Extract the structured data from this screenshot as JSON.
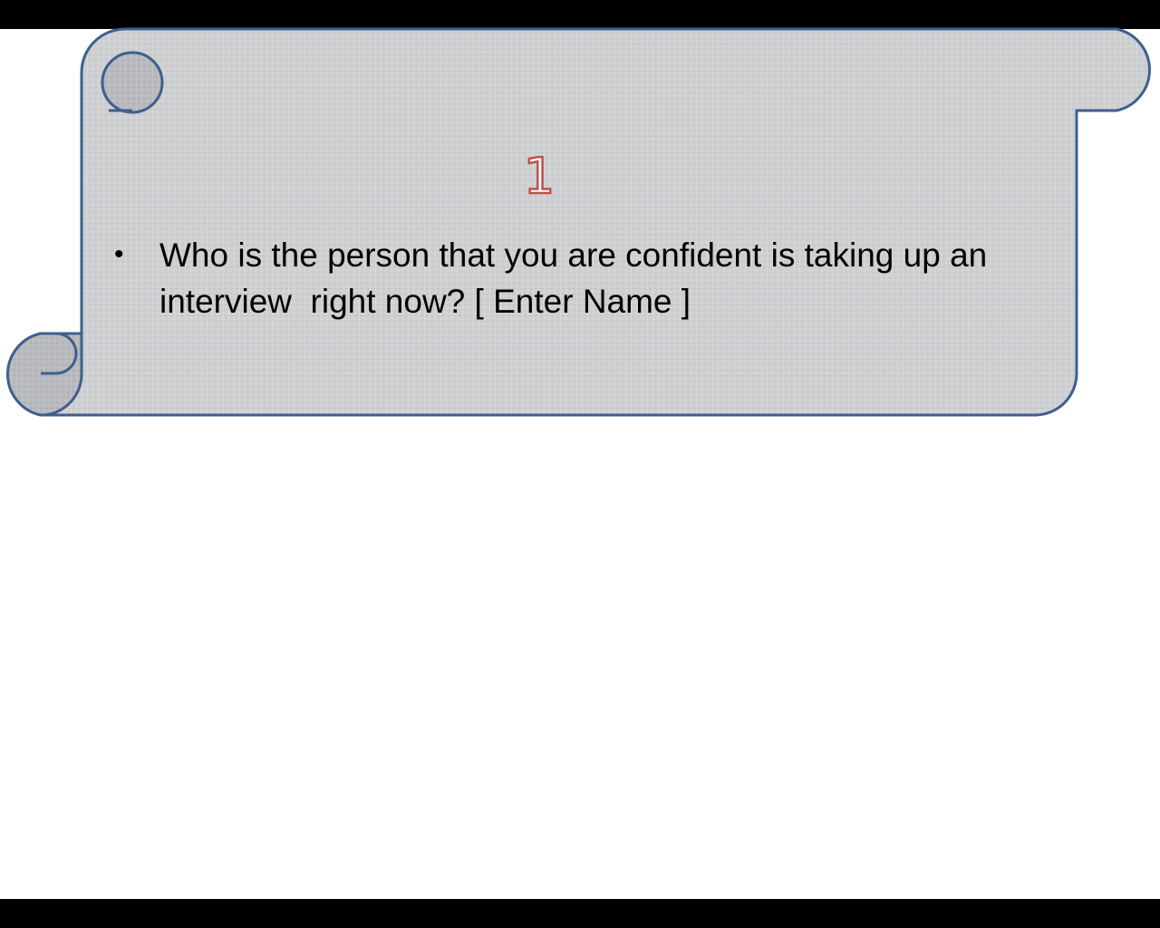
{
  "slide": {
    "number": "1",
    "bullet": "•",
    "question": "Who is the person that you are confident is taking up an interview  right now? [ Enter Name ]"
  },
  "colors": {
    "scroll_fill": "#cfd0d2",
    "scroll_outline": "#3f5f8f",
    "number_outline": "#c0504d",
    "letterbox": "#000000",
    "background": "#ffffff"
  }
}
